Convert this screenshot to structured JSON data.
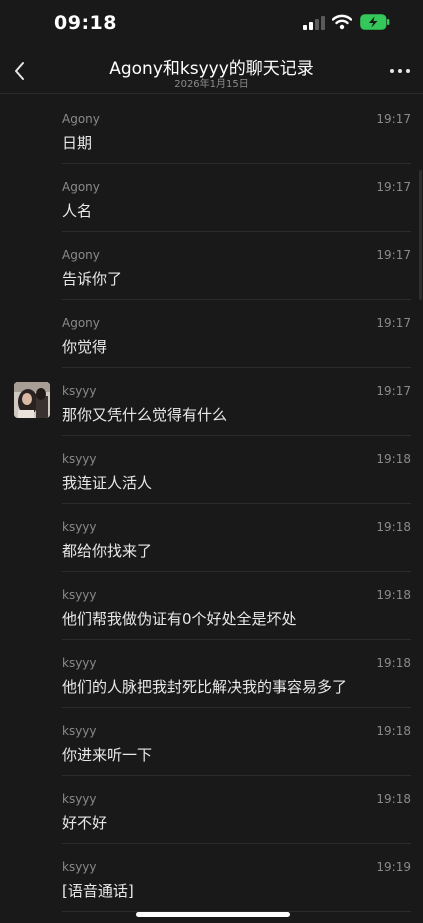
{
  "status_bar": {
    "time": "09:18"
  },
  "nav": {
    "title": "Agony和ksyyy的聊天记录",
    "subtitle": "2026年1月15日"
  },
  "messages": [
    {
      "sender": "Agony",
      "time": "19:17",
      "text": "日期"
    },
    {
      "sender": "Agony",
      "time": "19:17",
      "text": "人名"
    },
    {
      "sender": "Agony",
      "time": "19:17",
      "text": "告诉你了"
    },
    {
      "sender": "Agony",
      "time": "19:17",
      "text": "你觉得"
    },
    {
      "sender": "ksyyy",
      "time": "19:17",
      "text": "那你又凭什么觉得有什么"
    },
    {
      "sender": "ksyyy",
      "time": "19:18",
      "text": "我连证人活人"
    },
    {
      "sender": "ksyyy",
      "time": "19:18",
      "text": "都给你找来了"
    },
    {
      "sender": "ksyyy",
      "time": "19:18",
      "text": "他们帮我做伪证有0个好处全是坏处"
    },
    {
      "sender": "ksyyy",
      "time": "19:18",
      "text": "他们的人脉把我封死比解决我的事容易多了"
    },
    {
      "sender": "ksyyy",
      "time": "19:18",
      "text": "你进来听一下"
    },
    {
      "sender": "ksyyy",
      "time": "19:18",
      "text": "好不好"
    },
    {
      "sender": "ksyyy",
      "time": "19:19",
      "text": "[语音通话]"
    }
  ],
  "colors": {
    "background": "#191919",
    "battery_fill": "#34c759",
    "meta_text": "#8a8a8a"
  },
  "icons": [
    "back-arrow-icon",
    "more-dots-icon",
    "signal-icon",
    "wifi-icon",
    "battery-charging-icon"
  ]
}
